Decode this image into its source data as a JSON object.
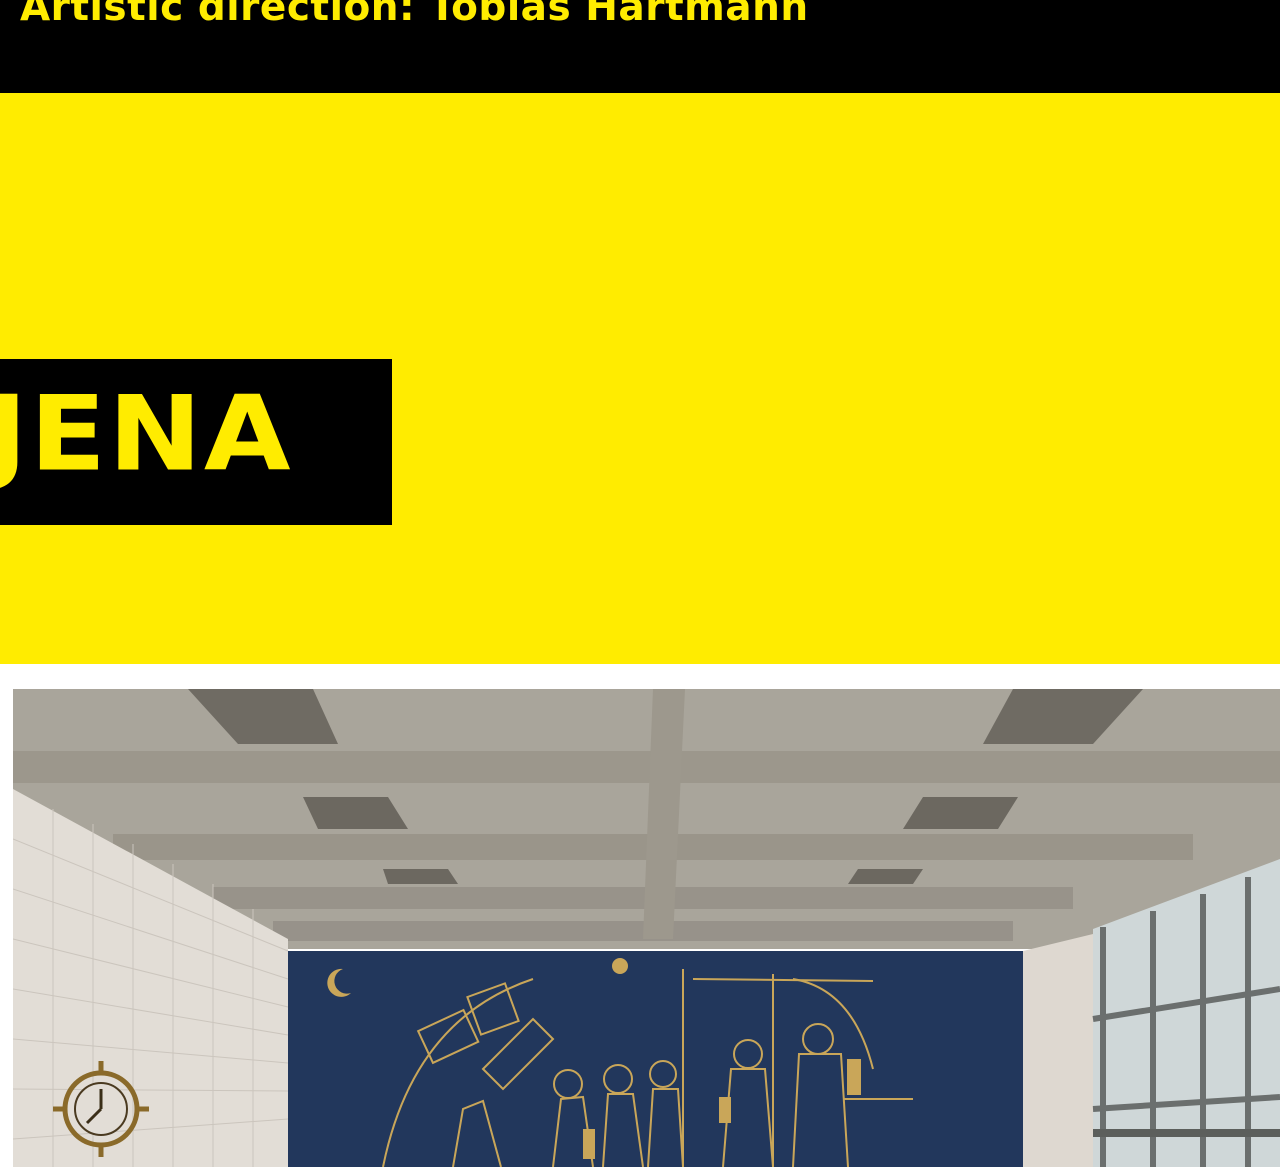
{
  "header": {
    "credit_line": "Artistic direction: Tobias Hartmann"
  },
  "hero": {
    "title": "JENA"
  },
  "photo": {
    "icon": "mural-hall-image"
  },
  "colors": {
    "accent_yellow": "#ffec00",
    "black": "#000000",
    "mural_blue": "#22375c"
  }
}
